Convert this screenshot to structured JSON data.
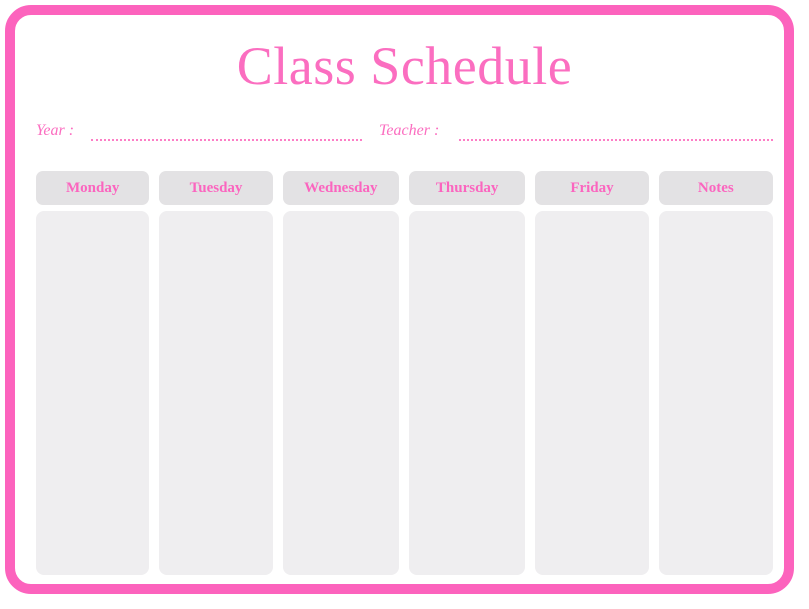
{
  "theme": {
    "frame_pink": "#fc63bd",
    "title_pink": "#fb6ec0",
    "header_text_pink": "#fb65bf",
    "dotted_line_pink": "#fd7ec6",
    "header_box_gray": "#e3e2e4",
    "body_box_gray": "#efeef0",
    "page_background": "#ffffff"
  },
  "header": {
    "title": "Class Schedule"
  },
  "meta": {
    "fields": [
      {
        "label": "Year :",
        "value": "",
        "placeholder": ""
      },
      {
        "label": "Teacher :",
        "value": "",
        "placeholder": ""
      }
    ]
  },
  "schedule": {
    "columns": [
      {
        "label": "Monday",
        "entries": []
      },
      {
        "label": "Tuesday",
        "entries": []
      },
      {
        "label": "Wednesday",
        "entries": []
      },
      {
        "label": "Thursday",
        "entries": []
      },
      {
        "label": "Friday",
        "entries": []
      },
      {
        "label": "Notes",
        "entries": []
      }
    ]
  }
}
